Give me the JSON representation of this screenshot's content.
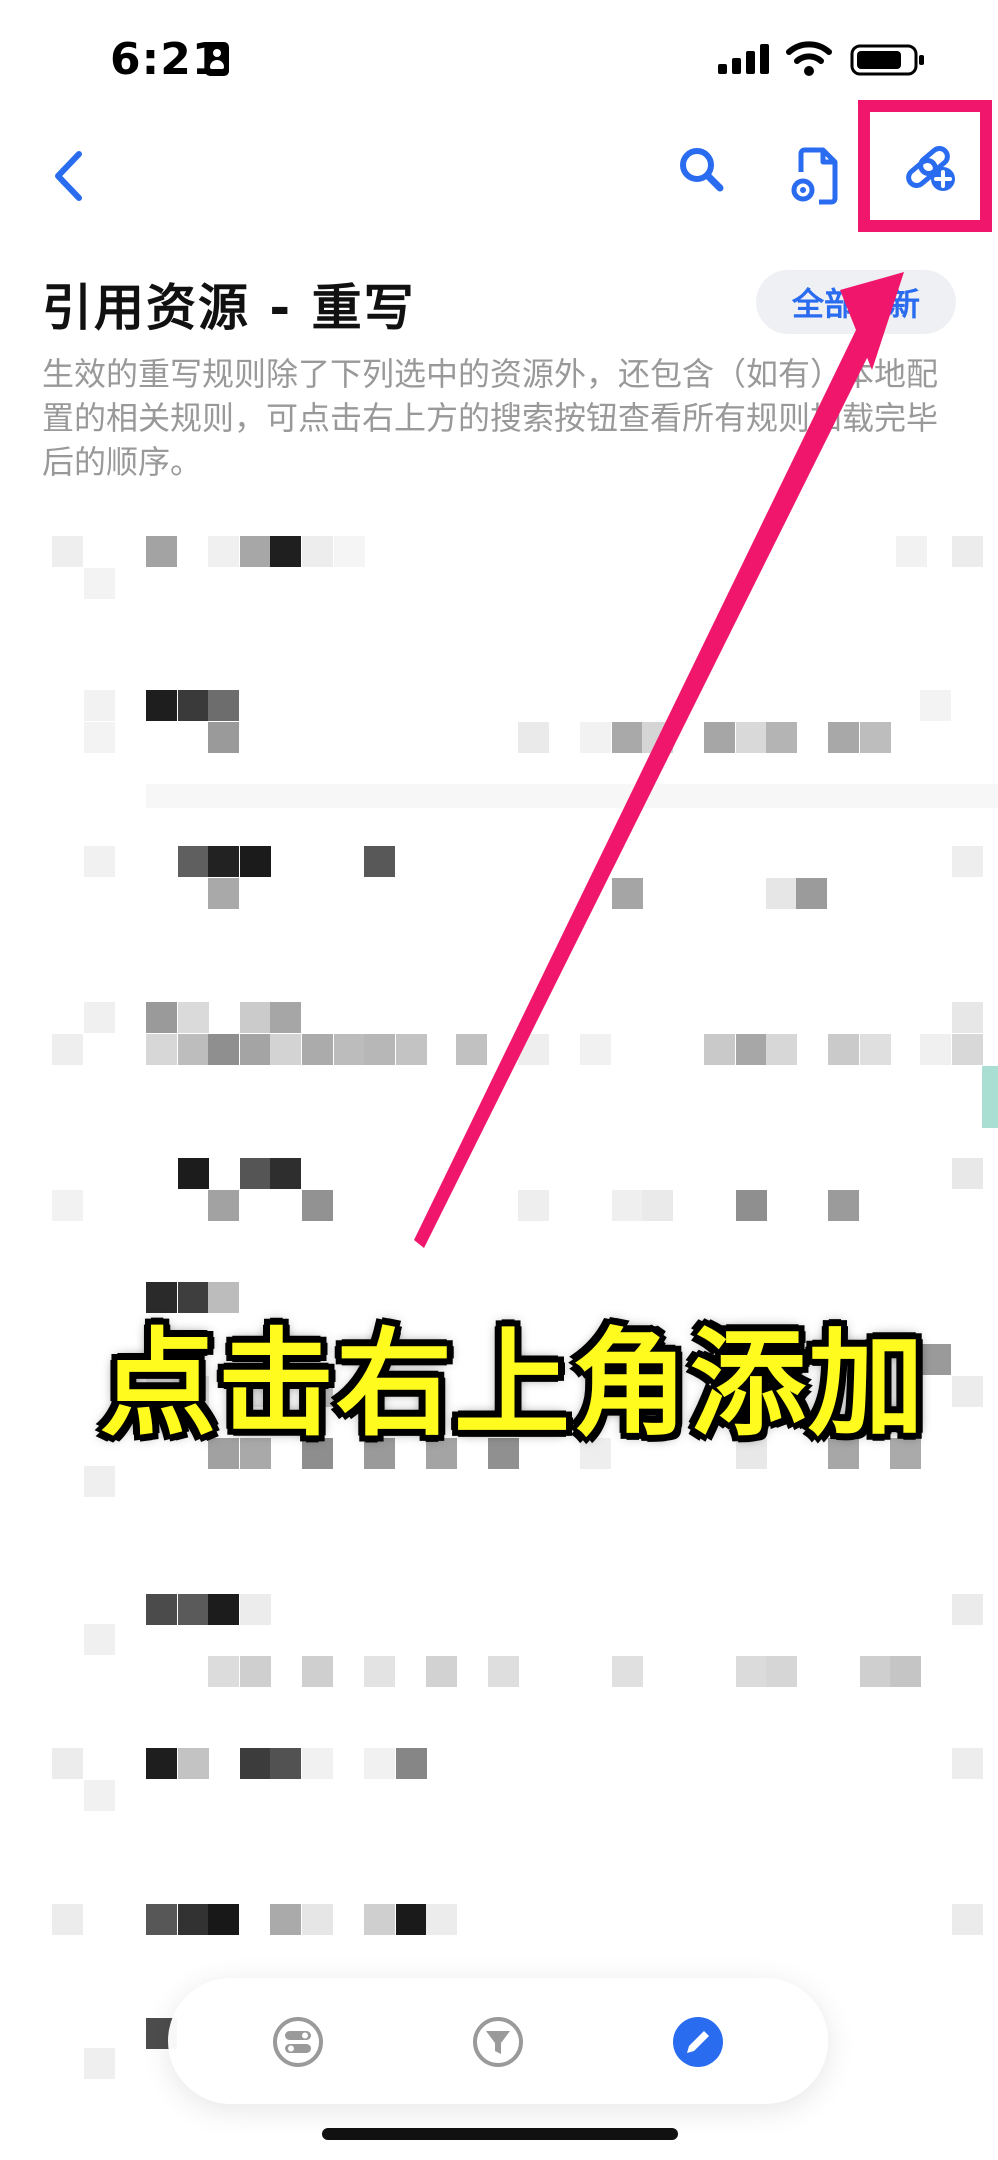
{
  "status_bar": {
    "time": "6:21",
    "icons": [
      "portrait-lock-icon",
      "cellular-signal-icon",
      "wifi-icon",
      "battery-icon"
    ]
  },
  "nav_bar": {
    "icons": [
      "chevron-left-icon",
      "search-icon",
      "document-gear-icon",
      "link-add-icon"
    ],
    "accent_color": "#2a6cf0"
  },
  "header": {
    "title": "引用资源 - 重写",
    "update_all_button": "全部更新",
    "description": "生效的重写规则除了下列选中的资源外，还包含（如有）本地配置的相关规则，可点击右上方的搜索按钮查看所有规则加载完毕后的顺序。"
  },
  "annotation": {
    "caption": "点击右上角添加",
    "highlight_color": "#f0166b",
    "caption_color": "#fffb1f"
  },
  "tab_bar": {
    "tabs": [
      {
        "icon": "toggle-list-icon",
        "active": false
      },
      {
        "icon": "filter-icon",
        "active": false
      },
      {
        "icon": "pencil-icon",
        "active": true
      }
    ]
  }
}
